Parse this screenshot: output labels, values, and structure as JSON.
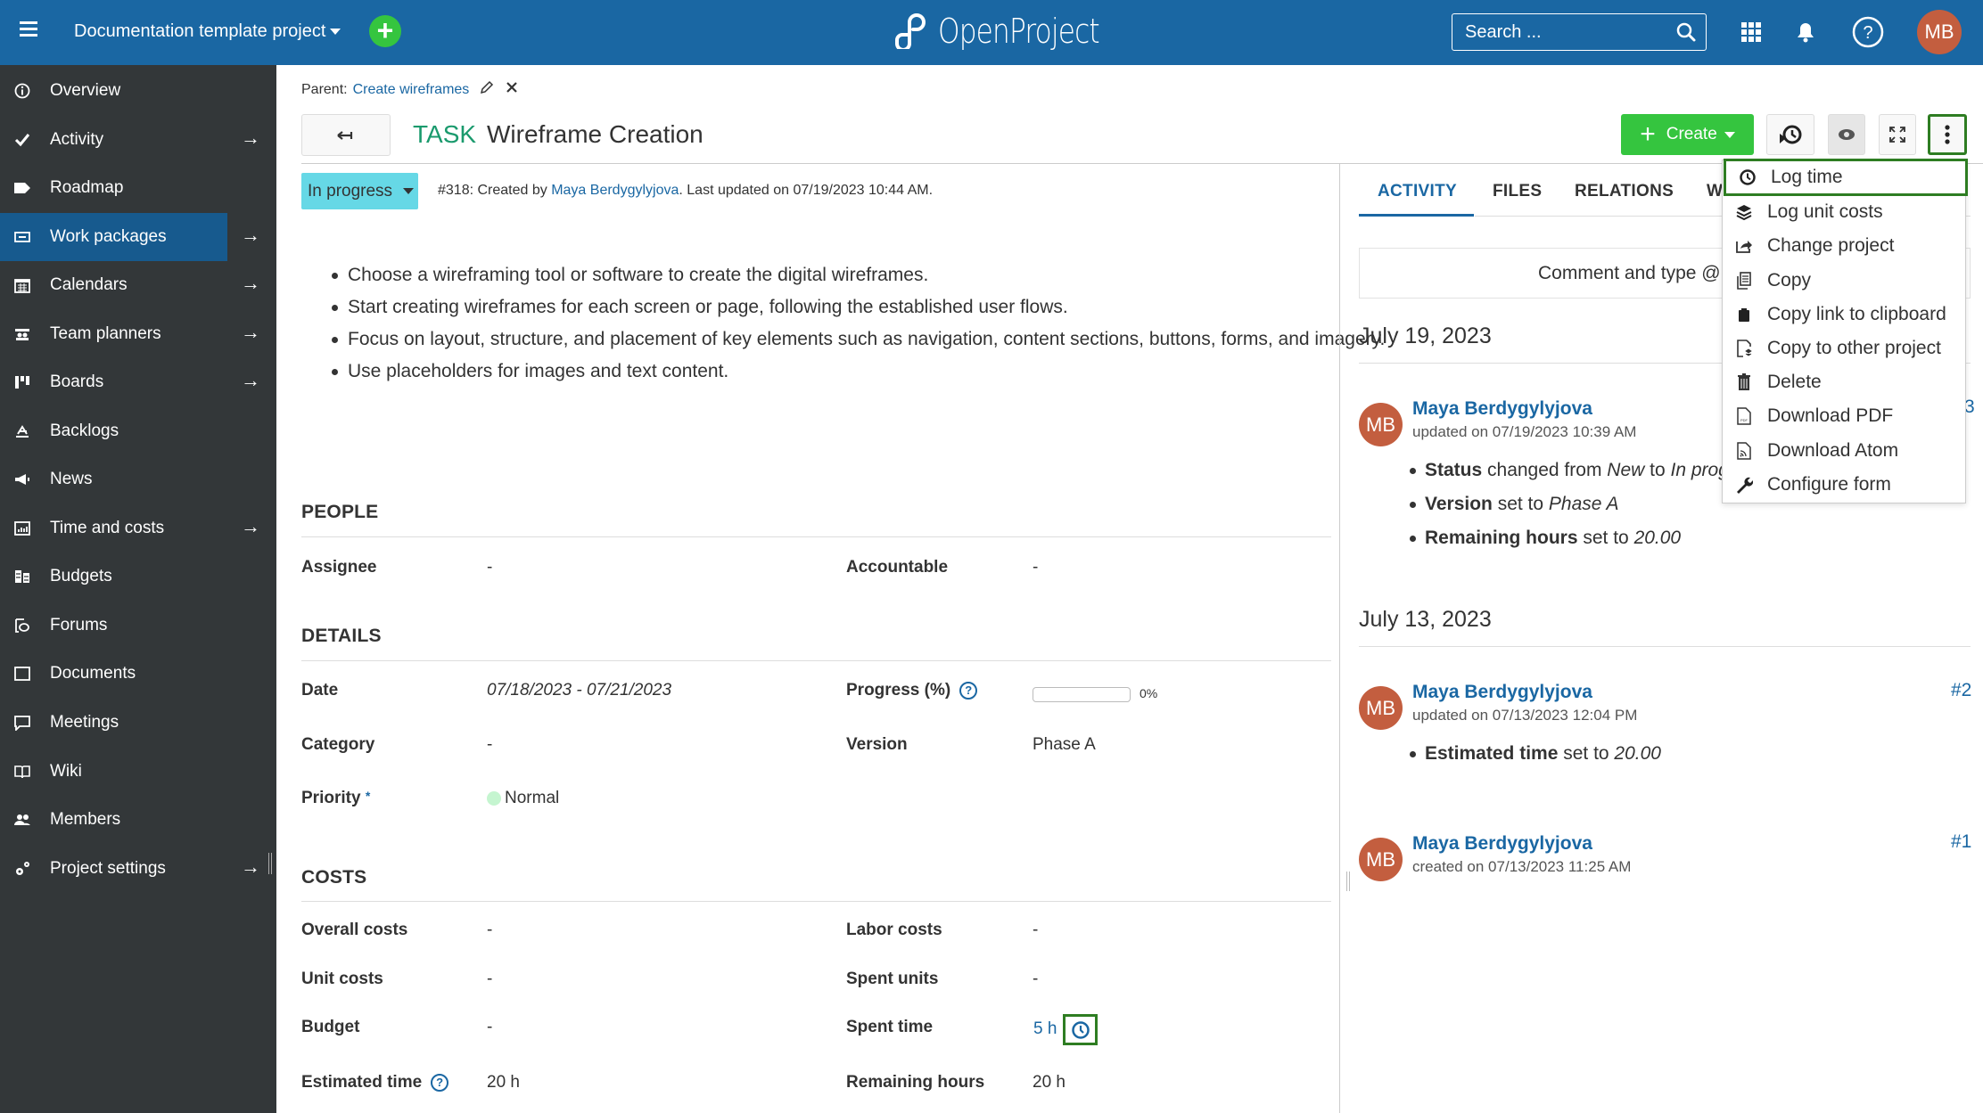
{
  "header": {
    "project_name": "Documentation template project",
    "logo_text": "OpenProject",
    "search_placeholder": "Search ...",
    "avatar_initials": "MB"
  },
  "sidebar": {
    "items": [
      {
        "label": "Overview",
        "icon": "info-icon",
        "arrow": false,
        "active": false
      },
      {
        "label": "Activity",
        "icon": "checkmark-icon",
        "arrow": true,
        "active": false
      },
      {
        "label": "Roadmap",
        "icon": "tag-icon",
        "arrow": false,
        "active": false
      },
      {
        "label": "Work packages",
        "icon": "work-packages-icon",
        "arrow": true,
        "active": true
      },
      {
        "label": "Calendars",
        "icon": "calendar-icon",
        "arrow": true,
        "active": false
      },
      {
        "label": "Team planners",
        "icon": "team-planner-icon",
        "arrow": true,
        "active": false
      },
      {
        "label": "Boards",
        "icon": "boards-icon",
        "arrow": true,
        "active": false
      },
      {
        "label": "Backlogs",
        "icon": "backlogs-icon",
        "arrow": false,
        "active": false
      },
      {
        "label": "News",
        "icon": "megaphone-icon",
        "arrow": false,
        "active": false
      },
      {
        "label": "Time and costs",
        "icon": "chart-icon",
        "arrow": true,
        "active": false
      },
      {
        "label": "Budgets",
        "icon": "budget-icon",
        "arrow": false,
        "active": false
      },
      {
        "label": "Forums",
        "icon": "forum-icon",
        "arrow": false,
        "active": false
      },
      {
        "label": "Documents",
        "icon": "document-icon",
        "arrow": false,
        "active": false
      },
      {
        "label": "Meetings",
        "icon": "speech-bubble-icon",
        "arrow": false,
        "active": false
      },
      {
        "label": "Wiki",
        "icon": "book-icon",
        "arrow": false,
        "active": false
      },
      {
        "label": "Members",
        "icon": "members-icon",
        "arrow": false,
        "active": false
      },
      {
        "label": "Project settings",
        "icon": "settings-icon",
        "arrow": true,
        "active": false
      }
    ]
  },
  "work_package": {
    "parent_label": "Parent:",
    "parent_link": "Create wireframes",
    "type": "TASK",
    "title": "Wireframe Creation",
    "create_label": "Create",
    "status": "In progress",
    "status_color": "#66d8e6",
    "meta_prefix": "#318: Created by ",
    "meta_author": "Maya Berdygylyjova",
    "meta_suffix": ". Last updated on 07/19/2023 10:44 AM.",
    "description": [
      "Choose a wireframing tool or software to create the digital wireframes.",
      "Start creating wireframes for each screen or page, following the established user flows.",
      "Focus on layout, structure, and placement of key elements such as navigation, content sections, buttons, forms, and imagery.",
      "Use placeholders for images and text content."
    ]
  },
  "sections": {
    "people": {
      "title": "PEOPLE",
      "assignee_label": "Assignee",
      "assignee_value": "-",
      "accountable_label": "Accountable",
      "accountable_value": "-"
    },
    "details": {
      "title": "DETAILS",
      "date_label": "Date",
      "date_value": "07/18/2023 - 07/21/2023",
      "progress_label": "Progress (%)",
      "progress_value": "0%",
      "progress_fraction": 0,
      "category_label": "Category",
      "category_value": "-",
      "version_label": "Version",
      "version_value": "Phase A",
      "priority_label": "Priority",
      "priority_required": "*",
      "priority_value": "Normal"
    },
    "costs": {
      "title": "COSTS",
      "overall_label": "Overall costs",
      "overall_value": "-",
      "labor_label": "Labor costs",
      "labor_value": "-",
      "unit_label": "Unit costs",
      "unit_value": "-",
      "spent_units_label": "Spent units",
      "spent_units_value": "-",
      "budget_label": "Budget",
      "budget_value": "-",
      "spent_time_label": "Spent time",
      "spent_time_value": "5 h",
      "estimated_label": "Estimated time",
      "estimated_value": "20 h",
      "remaining_label": "Remaining hours",
      "remaining_value": "20 h"
    }
  },
  "activity_panel": {
    "tabs": [
      "ACTIVITY",
      "FILES",
      "RELATIONS",
      "W"
    ],
    "comment_placeholder": "Comment and type @ to notify",
    "days": [
      {
        "date": "July 19, 2023",
        "entries": [
          {
            "initials": "MB",
            "user": "Maya Berdygylyjova",
            "time": "updated on 07/19/2023 10:39 AM",
            "number": "3",
            "changes": [
              {
                "field": "Status",
                "text": " changed from ",
                "from": "New",
                "mid": " to ",
                "to": "In progre"
              },
              {
                "field": "Version",
                "text": " set to ",
                "to": "Phase A"
              },
              {
                "field": "Remaining hours",
                "text": " set to ",
                "to": "20.00"
              }
            ]
          }
        ]
      },
      {
        "date": "July 13, 2023",
        "entries": [
          {
            "initials": "MB",
            "user": "Maya Berdygylyjova",
            "time": "updated on 07/13/2023 12:04 PM",
            "number": "#2",
            "changes": [
              {
                "field": "Estimated time",
                "text": " set to ",
                "to": "20.00"
              }
            ]
          },
          {
            "initials": "MB",
            "user": "Maya Berdygylyjova",
            "time": "created on 07/13/2023 11:25 AM",
            "number": "#1",
            "changes": []
          }
        ]
      }
    ]
  },
  "more_menu": {
    "items": [
      {
        "label": "Log time",
        "icon": "clock-icon"
      },
      {
        "label": "Log unit costs",
        "icon": "layers-icon"
      },
      {
        "label": "Change project",
        "icon": "move-icon"
      },
      {
        "label": "Copy",
        "icon": "copy-icon"
      },
      {
        "label": "Copy link to clipboard",
        "icon": "clipboard-icon"
      },
      {
        "label": "Copy to other project",
        "icon": "copy-project-icon"
      },
      {
        "label": "Delete",
        "icon": "trash-icon"
      },
      {
        "label": "Download PDF",
        "icon": "pdf-icon"
      },
      {
        "label": "Download Atom",
        "icon": "atom-feed-icon"
      },
      {
        "label": "Configure form",
        "icon": "wrench-icon"
      }
    ]
  },
  "colors": {
    "header": "#1a67a3",
    "sidebar": "#333739",
    "sidebar_active": "#175a8e",
    "accent_green": "#35c53f",
    "type_color": "#1a9a6d",
    "link": "#1a67a3",
    "avatar": "#c35e3f",
    "focus_outline": "#2e7d22"
  }
}
